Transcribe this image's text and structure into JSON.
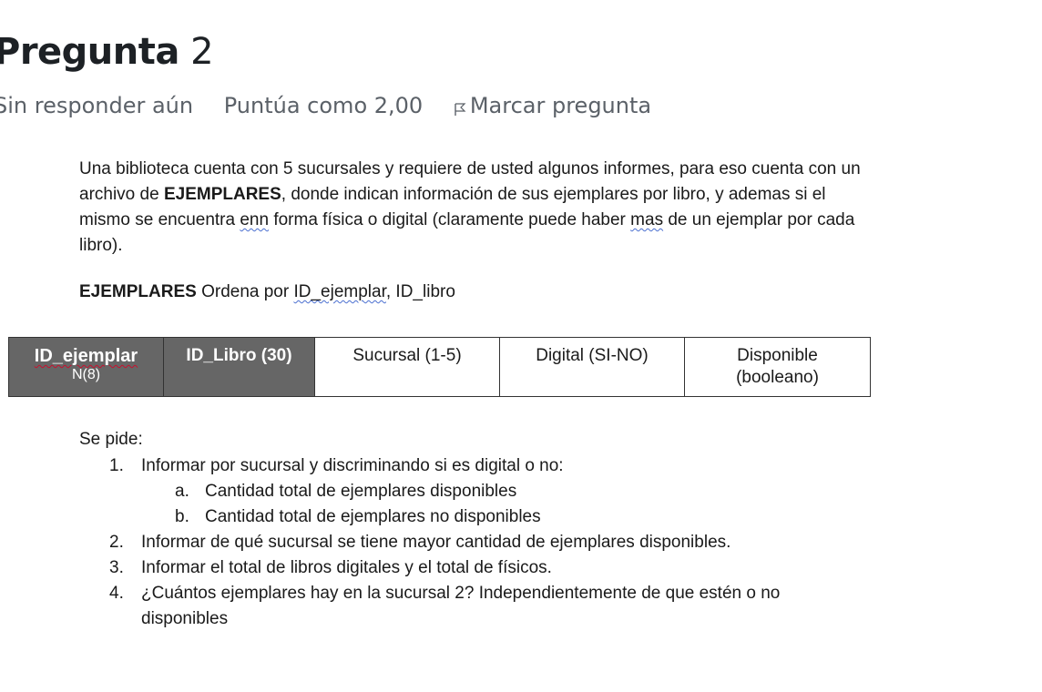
{
  "question": {
    "label": "Pregunta",
    "number": "2",
    "status": "Sin responder aún",
    "grade": "Puntúa como 2,00",
    "flag_label": "Marcar pregunta",
    "flag_icon": "flag-icon"
  },
  "intro": {
    "pre": "Una biblioteca cuenta con 5 sucursales y requiere de usted algunos informes, para eso cuenta con un archivo de ",
    "bold": "EJEMPLARES",
    "mid": ", donde indican información de sus ejemplares por libro, y ademas si el mismo se encuentra ",
    "squig1": "enn",
    "mid2": " forma física o digital (claramente puede haber ",
    "squig2": "mas",
    "post": " de un ejemplar por cada libro)."
  },
  "sorted": {
    "bold": "EJEMPLARES",
    "text": " Ordena por ",
    "squig": "ID_ejemplar",
    "rest": ", ID_libro"
  },
  "table": {
    "col1_title": "ID_ejemplar",
    "col1_sub": "N(8)",
    "col2_bold": "ID_Libro",
    "col2_rest": " (30)",
    "col3": "Sucursal (1-5)",
    "col4": "Digital (SI-NO)",
    "col5_line1": "Disponible",
    "col5_line2": "(booleano)"
  },
  "task": {
    "header": "Se pide:",
    "items": [
      {
        "n": "1.",
        "text": "Informar por sucursal y discriminando si es digital o no:"
      },
      {
        "n": "a.",
        "text": "Cantidad  total de ejemplares disponibles"
      },
      {
        "n": "b.",
        "text": "Cantidad total de ejemplares no disponibles"
      },
      {
        "n": "2.",
        "text": "Informar de qué sucursal se tiene mayor cantidad de ejemplares disponibles."
      },
      {
        "n": "3.",
        "text": "Informar el total de libros digitales y el total de físicos."
      },
      {
        "n": "4.",
        "text": "¿Cuántos ejemplares hay en la sucursal 2? Independientemente de que estén o no disponibles"
      }
    ]
  }
}
